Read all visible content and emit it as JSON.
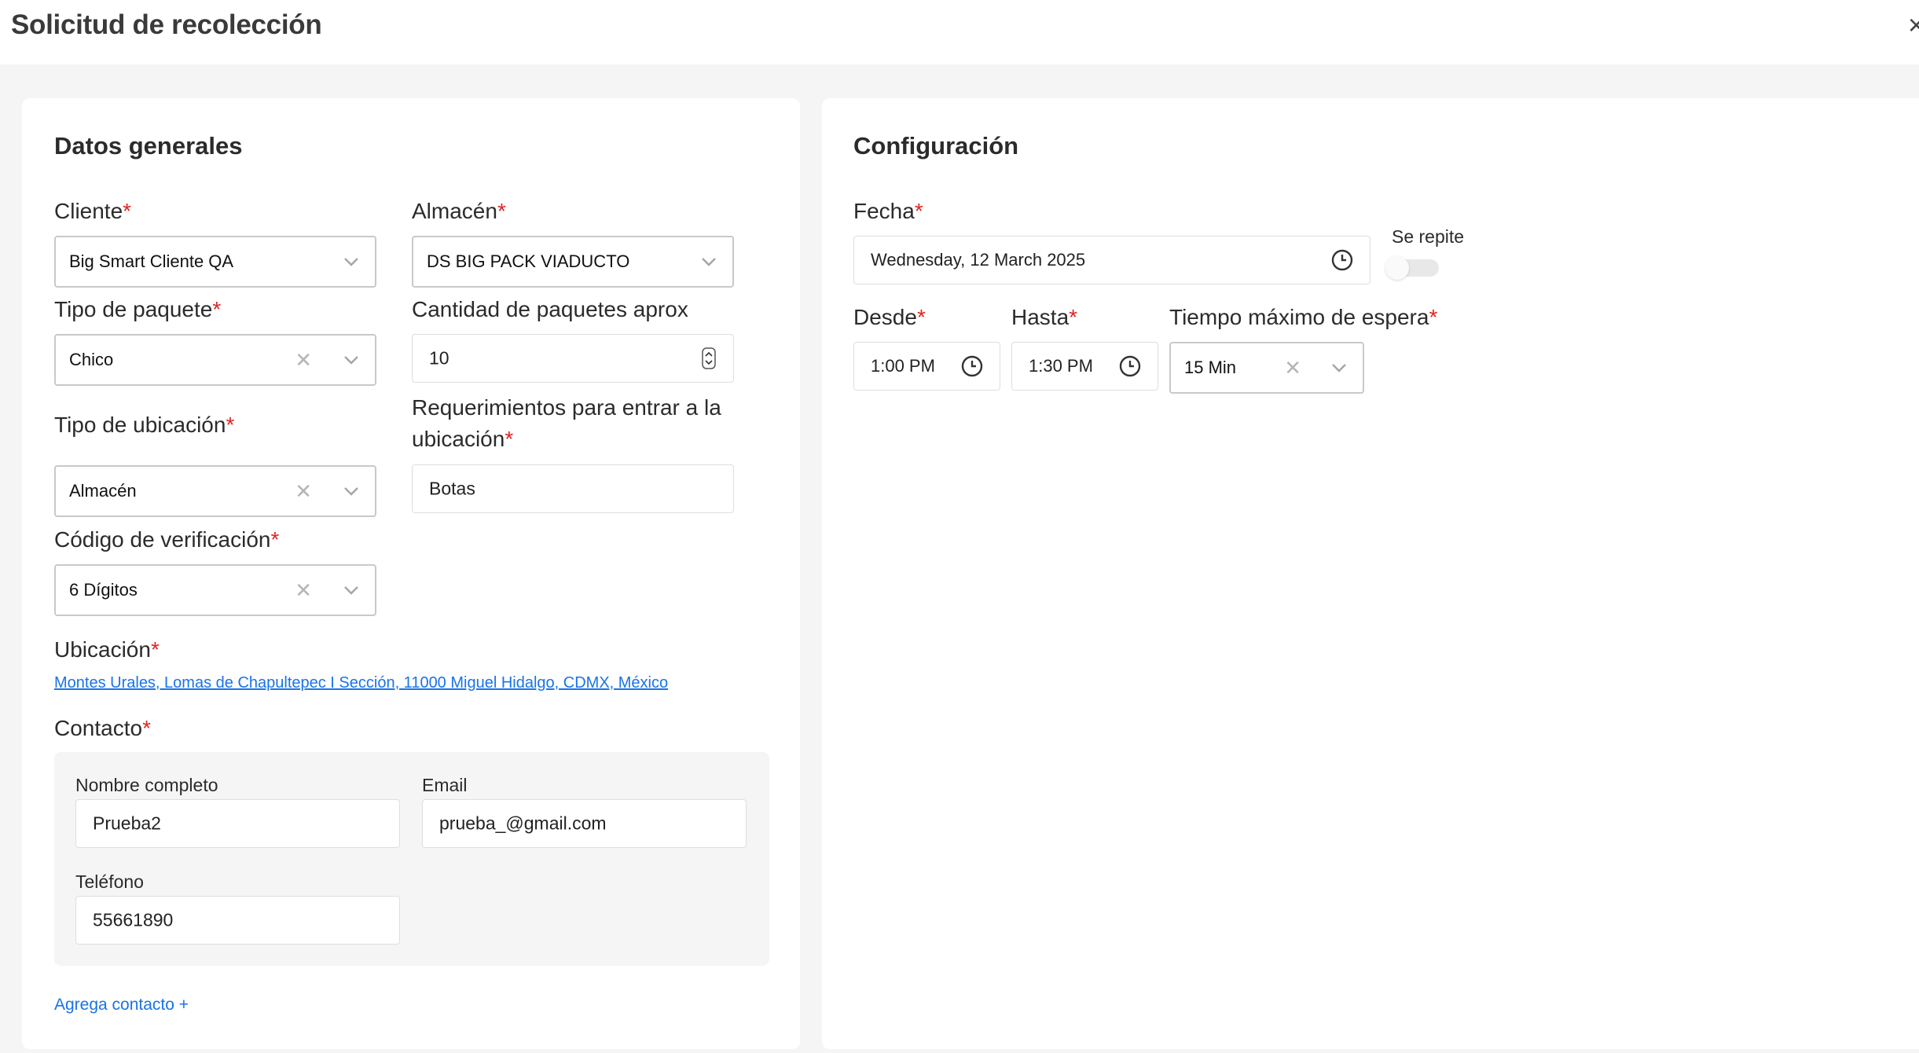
{
  "header": {
    "title": "Solicitud de recolección",
    "close_label": "×"
  },
  "general": {
    "title": "Datos generales",
    "cliente": {
      "label": "Cliente",
      "required_mark": "*",
      "value": "Big Smart Cliente QA"
    },
    "almacen": {
      "label": "Almacén",
      "required_mark": "*",
      "value": "DS BIG PACK VIADUCTO"
    },
    "tipo_paquete": {
      "label": "Tipo de paquete",
      "required_mark": "*",
      "value": "Chico"
    },
    "cantidad": {
      "label": "Cantidad de paquetes aprox",
      "value": "10"
    },
    "tipo_ubicacion": {
      "label": "Tipo de ubicación",
      "required_mark": "*",
      "value": "Almacén"
    },
    "requerimientos": {
      "label_line1": "Requerimientos para entrar a la",
      "label_line2": "ubicación",
      "required_mark": "*",
      "value": "Botas"
    },
    "codigo": {
      "label": "Código de verificación",
      "required_mark": "*",
      "value": "6 Dígitos"
    },
    "ubicacion": {
      "label": "Ubicación",
      "required_mark": "*",
      "address": "Montes Urales, Lomas de Chapultepec I Sección, 11000 Miguel Hidalgo, CDMX, México"
    },
    "contacto": {
      "label": "Contacto",
      "required_mark": "*",
      "nombre_label": "Nombre completo",
      "nombre_value": "Prueba2",
      "email_label": "Email",
      "email_value": "prueba_@gmail.com",
      "telefono_label": "Teléfono",
      "telefono_value": "55661890",
      "add_label": "Agrega contacto +"
    }
  },
  "config": {
    "title": "Configuración",
    "fecha": {
      "label": "Fecha",
      "required_mark": "*",
      "value": "Wednesday, 12 March 2025"
    },
    "repite": {
      "label": "Se repite",
      "on": false
    },
    "desde": {
      "label": "Desde",
      "required_mark": "*",
      "value": "1:00 PM"
    },
    "hasta": {
      "label": "Hasta",
      "required_mark": "*",
      "value": "1:30 PM"
    },
    "espera": {
      "label": "Tiempo máximo de espera",
      "required_mark": "*",
      "value": "15 Min"
    }
  },
  "colors": {
    "accent_link": "#1a73e8",
    "required": "#e02424"
  }
}
